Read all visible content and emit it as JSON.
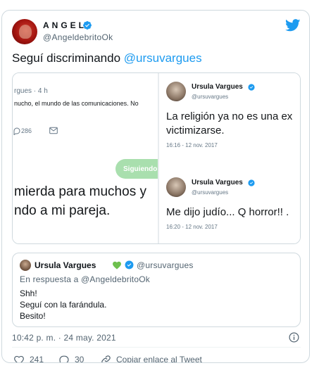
{
  "tweet": {
    "author_name": "ANGEL",
    "author_handle": "@AngeldebritoOk",
    "text_prefix": "Seguí discriminando ",
    "text_mention": "@ursuvargues",
    "timestamp": "10:42 p. m. · 24 may. 2021"
  },
  "media": {
    "left": {
      "meta": "rgues · 4 h",
      "snippet": "nucho, el mundo de las comunicaciones. No ",
      "replies": "286",
      "follow_label": "Siguiendo",
      "line1": "mierda para muchos y",
      "line2": "ndo a mi pareja."
    },
    "right": {
      "tweets": [
        {
          "name": "Ursula Vargues",
          "handle": "@ursuvargues",
          "line1": "La religión ya no es una ex",
          "line2": "victimizarse.",
          "time": "16:16 - 12 nov. 2017"
        },
        {
          "name": "Ursula Vargues",
          "handle": "@ursuvargues",
          "line1": "Me dijo judío... Q horror!! .",
          "line2": "",
          "time": "16:20 - 12 nov. 2017"
        }
      ]
    }
  },
  "quoted": {
    "name": "Ursula Vargues",
    "handle": "@ursuvargues",
    "in_reply_to": "En respuesta a @AngeldebritoOk",
    "lines": [
      "Shh!",
      "Seguí con la farándula.",
      "Besito!"
    ]
  },
  "actions": {
    "likes": "241",
    "replies": "30",
    "copy_link": "Copiar enlace al Tweet"
  },
  "colors": {
    "accent": "#1d9bf0",
    "follow_button": "#a9dfae",
    "heart": "#6ec04e"
  },
  "icons": [
    "verified-badge-icon",
    "twitter-bird-icon",
    "green-heart-icon",
    "info-icon",
    "like-icon",
    "reply-icon",
    "link-icon",
    "mail-icon"
  ]
}
